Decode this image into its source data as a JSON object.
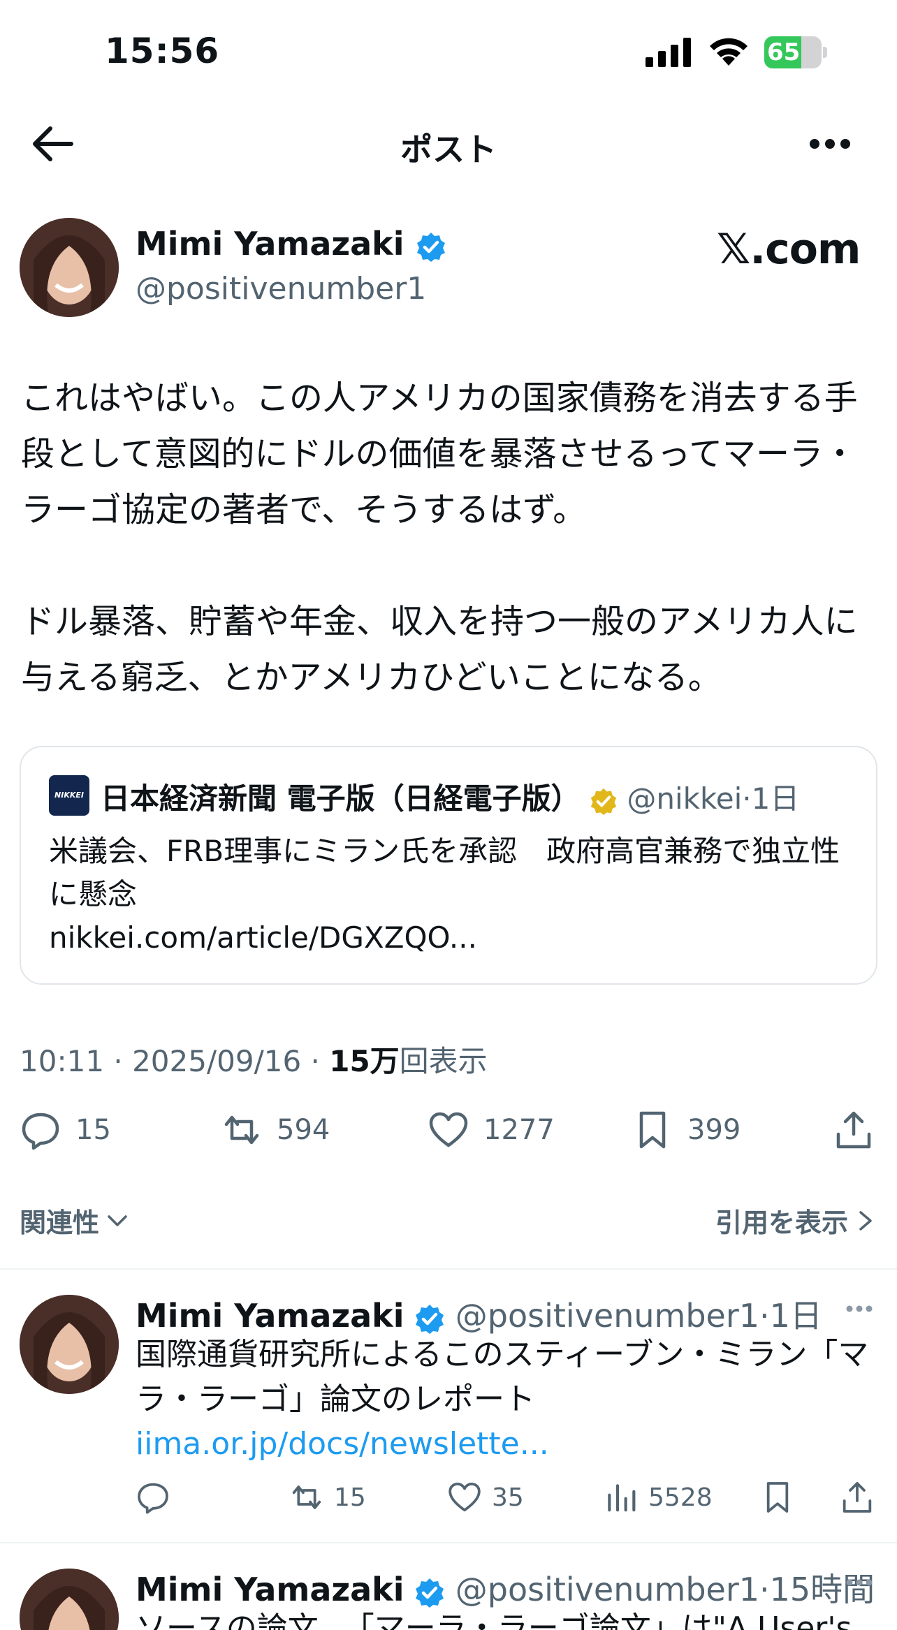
{
  "status_bar": {
    "time": "15:56",
    "battery": "65",
    "battery_level": 0.65
  },
  "header": {
    "title": "ポスト"
  },
  "main_tweet": {
    "author_name": "Mimi Yamazaki",
    "handle": "@positivenumber1",
    "site_badge": "𝕏.com",
    "text": "これはやばい。この人アメリカの国家債務を消去する手段として意図的にドルの価値を暴落させるってマーラ・ラーゴ協定の著者で、そうするはず。\n\nドル暴落、貯蓄や年金、収入を持つ一般のアメリカ人に与える窮乏、とかアメリカひどいことになる。",
    "quote": {
      "logo_text": "NIKKEI",
      "name": "日本経済新聞 電子版（日経電子版）",
      "handle": "@nikkei",
      "time": "·1日",
      "text": "米議会、FRB理事にミラン氏を承認　政府高官兼務で独立性に懸念",
      "link": "nikkei.com/article/DGXZQO..."
    },
    "timestamp": "10:11 · 2025/09/16 · ",
    "views_count": "15万",
    "views_label": "回表示",
    "stats": {
      "replies": "15",
      "retweets": "594",
      "likes": "1277",
      "bookmarks": "399"
    }
  },
  "filter": {
    "sort_label": "関連性",
    "quotes_label": "引用を表示"
  },
  "replies": [
    {
      "author_name": "Mimi Yamazaki",
      "handle": "@positivenumber1",
      "time": "·1日",
      "text": "国際通貨研究所によるこのスティーブン・ミラン「マラ・ラーゴ」論文のレポート",
      "link": "iima.or.jp/docs/newslette...",
      "stats": {
        "replies": "",
        "retweets": "15",
        "likes": "35",
        "views": "5528"
      }
    },
    {
      "author_name": "Mimi Yamazaki",
      "handle": "@positivenumber1",
      "time": "·15時間",
      "text": "ソースの論文 、「マーラ・ラーゴ論文」は\"A User's"
    }
  ],
  "colors": {
    "accent": "#1d9bf0",
    "verified_blue": "#1d9bf0",
    "verified_gold": "#e2b719",
    "muted": "#536471"
  }
}
